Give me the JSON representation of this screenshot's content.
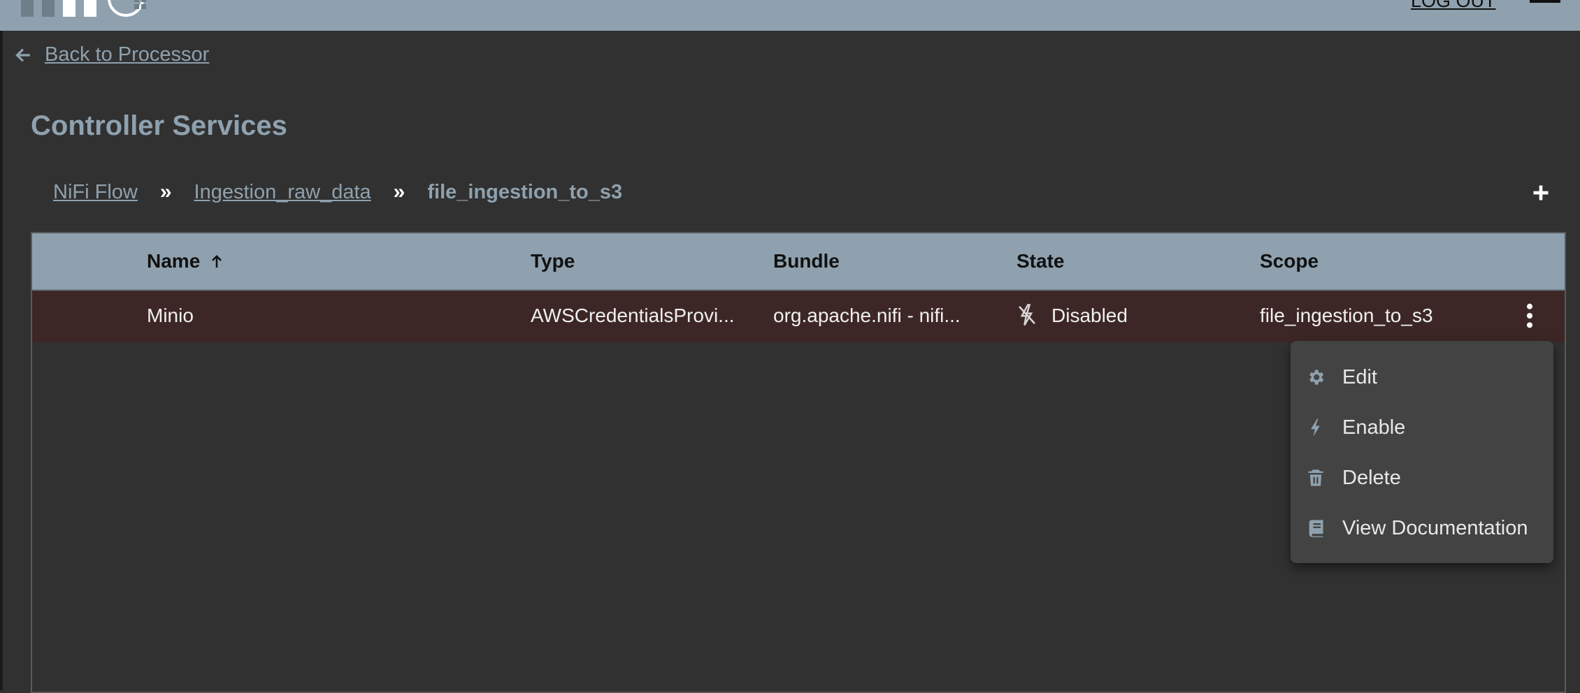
{
  "header": {
    "logout_label": "LOG OUT"
  },
  "nav": {
    "back_label": "Back to Processor"
  },
  "page": {
    "title": "Controller Services"
  },
  "breadcrumb": {
    "items": [
      "NiFi Flow",
      "Ingestion_raw_data"
    ],
    "separator": "»",
    "current": "file_ingestion_to_s3"
  },
  "toolbar": {
    "add_icon": "plus-icon"
  },
  "table": {
    "columns": {
      "name": "Name",
      "type": "Type",
      "bundle": "Bundle",
      "state": "State",
      "scope": "Scope"
    },
    "sort": {
      "column": "name",
      "direction": "ascending",
      "icon": "arrow-up-icon"
    },
    "rows": [
      {
        "name": "Minio",
        "type": "AWSCredentialsProvi...",
        "bundle": "org.apache.nifi - nifi...",
        "state": "Disabled",
        "state_icon": "disabled-bolt-icon",
        "scope": "file_ingestion_to_s3"
      }
    ]
  },
  "context_menu": {
    "items": [
      {
        "label": "Edit",
        "icon": "gear-icon"
      },
      {
        "label": "Enable",
        "icon": "bolt-icon"
      },
      {
        "label": "Delete",
        "icon": "trash-icon"
      },
      {
        "label": "View Documentation",
        "icon": "book-icon"
      }
    ]
  },
  "colors": {
    "header_bg": "#8fa1ae",
    "page_bg": "#313131",
    "row_highlight": "#3d2726",
    "menu_bg": "#434343",
    "link": "#8fa1ae"
  }
}
